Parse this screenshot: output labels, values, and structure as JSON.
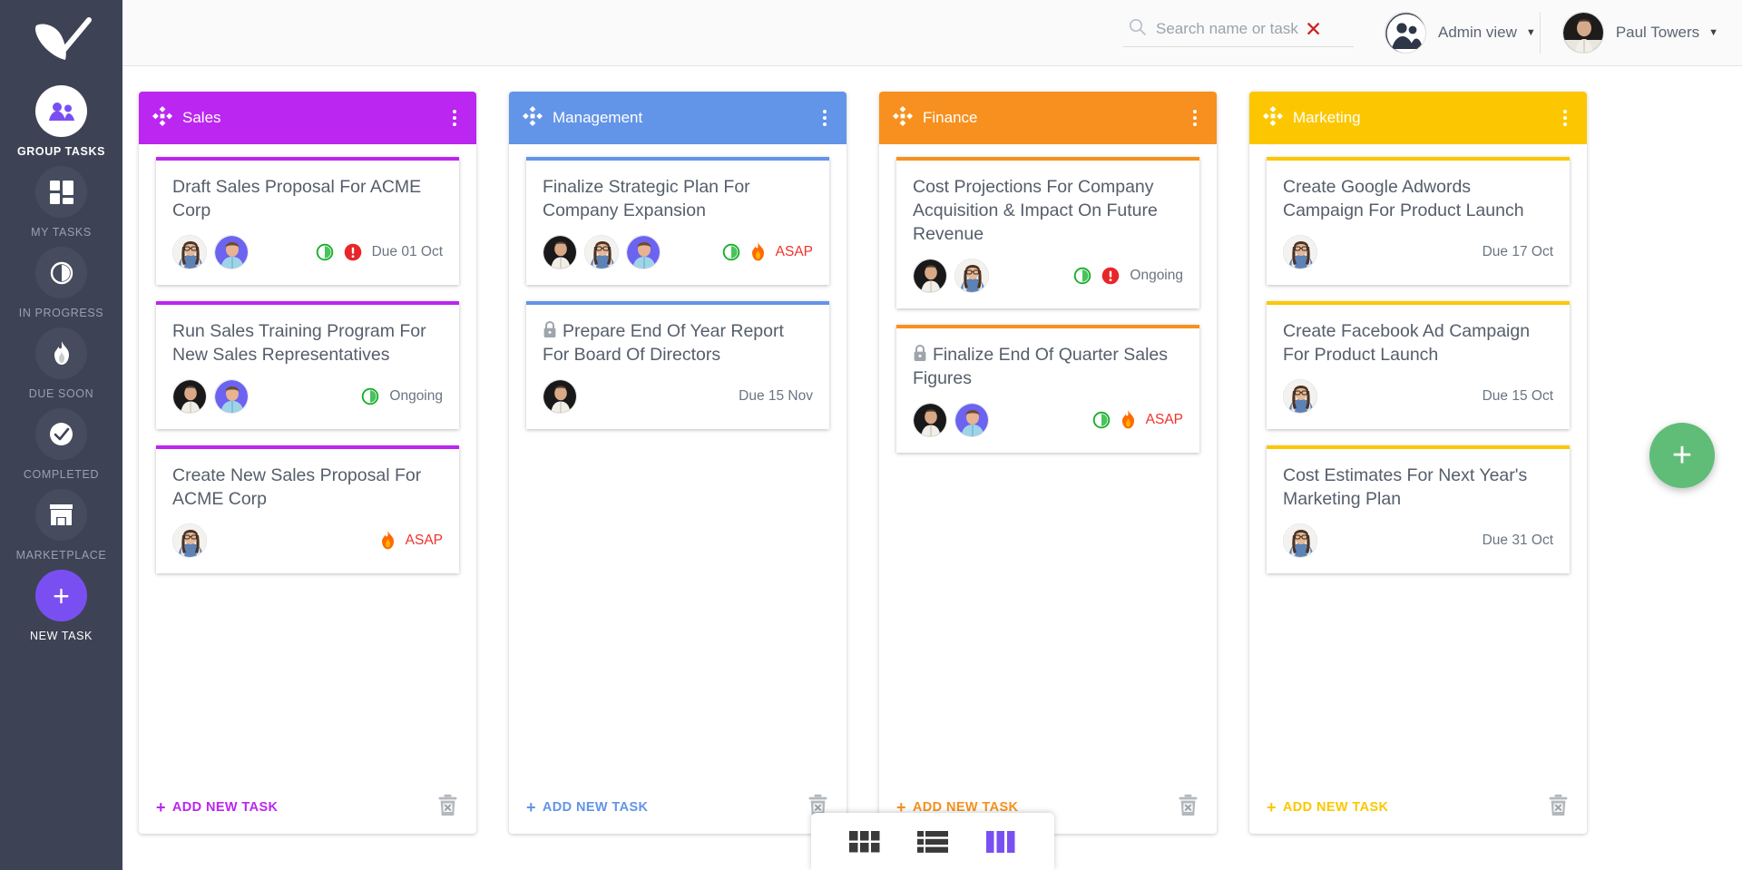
{
  "sidebar": {
    "logo_icon": "bird-check-logo",
    "items": [
      {
        "label": "GROUP TASKS",
        "icon": "group-people-icon",
        "active": true
      },
      {
        "label": "MY TASKS",
        "icon": "dashboard-grid-icon",
        "active": false
      },
      {
        "label": "IN PROGRESS",
        "icon": "half-circle-progress-icon",
        "active": false
      },
      {
        "label": "DUE SOON",
        "icon": "flame-icon",
        "active": false
      },
      {
        "label": "COMPLETED",
        "icon": "check-circle-icon",
        "active": false
      },
      {
        "label": "MARKETPLACE",
        "icon": "storefront-icon",
        "active": false
      }
    ],
    "new_task": {
      "label": "NEW TASK",
      "icon": "plus-icon",
      "color": "#7a4ff2"
    }
  },
  "header": {
    "search": {
      "placeholder": "Search name or task",
      "value": "",
      "icon": "search-icon",
      "clear_icon": "close-x-icon",
      "clear_color": "#cf2222"
    },
    "view_selector": {
      "label": "Admin view",
      "icon": "group-people-avatar",
      "caret": "▼"
    },
    "user": {
      "label": "Paul Towers",
      "avatar": "paul-towers-avatar",
      "caret": "▼"
    }
  },
  "board": {
    "add_task_label": "ADD NEW TASK",
    "add_task_plus": "+",
    "columns": [
      {
        "title": "Sales",
        "color": "#bb26f0",
        "move_icon": "move-4way-icon",
        "menu_icon": "kebab-menu-icon",
        "delete_icon": "trash-delete-icon",
        "cards": [
          {
            "title": "Draft Sales Proposal For ACME Corp",
            "locked": false,
            "avatars": [
              "woman-glasses-avatar",
              "man-purple-avatar"
            ],
            "badges": [
              "in-progress-icon",
              "urgent-alert-icon"
            ],
            "status": "Due 01 Oct",
            "status_kind": "due"
          },
          {
            "title": "Run Sales Training Program For New Sales Representatives",
            "locked": false,
            "avatars": [
              "man-dark-avatar",
              "man-purple-avatar"
            ],
            "badges": [
              "in-progress-icon"
            ],
            "status": "Ongoing",
            "status_kind": "normal"
          },
          {
            "title": "Create New Sales Proposal For ACME Corp",
            "locked": false,
            "avatars": [
              "woman-glasses-avatar"
            ],
            "badges": [
              "flame-icon"
            ],
            "status": "ASAP",
            "status_kind": "asap"
          }
        ]
      },
      {
        "title": "Management",
        "color": "#6294e8",
        "move_icon": "move-4way-icon",
        "menu_icon": "kebab-menu-icon",
        "delete_icon": "trash-delete-icon",
        "cards": [
          {
            "title": "Finalize Strategic Plan For Company Expansion",
            "locked": false,
            "avatars": [
              "man-dark-avatar",
              "woman-glasses-avatar",
              "man-purple-avatar"
            ],
            "badges": [
              "in-progress-icon",
              "flame-icon"
            ],
            "status": "ASAP",
            "status_kind": "asap"
          },
          {
            "title": "Prepare End Of Year Report For Board Of Directors",
            "locked": true,
            "avatars": [
              "man-dark-avatar"
            ],
            "badges": [],
            "status": "Due 15 Nov",
            "status_kind": "due"
          }
        ]
      },
      {
        "title": "Finance",
        "color": "#f7901e",
        "move_icon": "move-4way-icon",
        "menu_icon": "kebab-menu-icon",
        "delete_icon": "trash-delete-icon",
        "cards": [
          {
            "title": "Cost Projections For Company Acquisition & Impact On Future Revenue",
            "locked": false,
            "avatars": [
              "man-dark-avatar",
              "woman-glasses-avatar"
            ],
            "badges": [
              "in-progress-icon",
              "urgent-alert-icon"
            ],
            "status": "Ongoing",
            "status_kind": "normal"
          },
          {
            "title": "Finalize End Of Quarter Sales Figures",
            "locked": true,
            "avatars": [
              "man-dark-avatar",
              "man-purple-avatar"
            ],
            "badges": [
              "in-progress-icon",
              "flame-icon"
            ],
            "status": "ASAP",
            "status_kind": "asap"
          }
        ]
      },
      {
        "title": "Marketing",
        "color": "#fcc700",
        "move_icon": "move-4way-icon",
        "menu_icon": "kebab-menu-icon",
        "delete_icon": "trash-delete-icon",
        "cards": [
          {
            "title": "Create Google Adwords Campaign For Product Launch",
            "locked": false,
            "avatars": [
              "woman-glasses-avatar"
            ],
            "badges": [],
            "status": "Due 17 Oct",
            "status_kind": "due"
          },
          {
            "title": "Create Facebook Ad Campaign For Product Launch",
            "locked": false,
            "avatars": [
              "woman-glasses-avatar"
            ],
            "badges": [],
            "status": "Due 15 Oct",
            "status_kind": "due"
          },
          {
            "title": "Cost Estimates For Next Year's Marketing Plan",
            "locked": false,
            "avatars": [
              "woman-glasses-avatar"
            ],
            "badges": [],
            "status": "Due 31 Oct",
            "status_kind": "due"
          }
        ]
      }
    ]
  },
  "fab": {
    "icon": "plus-icon",
    "color": "#5fbd77"
  },
  "view_switcher": {
    "options": [
      {
        "name": "grid-view",
        "active": false
      },
      {
        "name": "list-view",
        "active": false
      },
      {
        "name": "column-view",
        "active": true
      }
    ],
    "active_color": "#7a4ff2",
    "inactive_color": "#3a3a3a"
  }
}
